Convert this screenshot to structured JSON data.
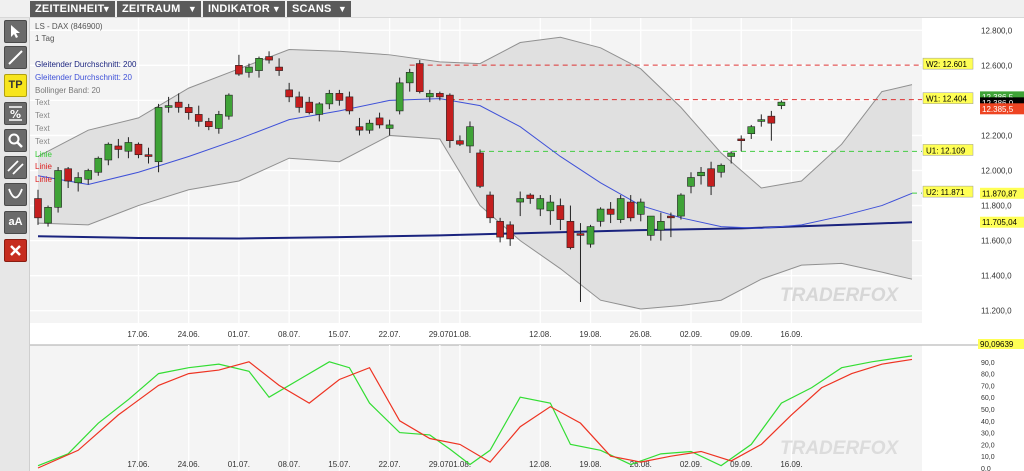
{
  "menu": [
    {
      "label": "ZEITEINHEIT"
    },
    {
      "label": "ZEITRAUM"
    },
    {
      "label": "INDIKATOR"
    },
    {
      "label": "SCANS"
    }
  ],
  "tools": [
    {
      "name": "cursor-icon",
      "label": ""
    },
    {
      "name": "line-tool-icon",
      "label": ""
    },
    {
      "name": "tp-tool-button",
      "label": "TP"
    },
    {
      "name": "percent-tool-icon",
      "label": ""
    },
    {
      "name": "zoom-icon",
      "label": ""
    },
    {
      "name": "channel-tool-icon",
      "label": ""
    },
    {
      "name": "curve-tool-icon",
      "label": ""
    },
    {
      "name": "font-size-button",
      "label": "aA"
    },
    {
      "name": "delete-icon",
      "label": ""
    }
  ],
  "colors": {
    "up": "#3fa337",
    "down": "#c41e1e",
    "sma200": "#1a237e",
    "sma20": "#3f51d8",
    "bollinger": "#909090",
    "stoch_k": "#33dd33",
    "stoch_d": "#ee3322",
    "resistance": "#dd3333",
    "support": "#44cc44",
    "tag_bg": "#ffff55"
  },
  "watermark": "TRADERFOX",
  "chart_data": {
    "type": "candlestick",
    "title": "LS - DAX (846900)",
    "subtitle": "1 Tag",
    "legend": [
      {
        "text": "Gleitender Durchschnitt: 200",
        "color": "#1a237e"
      },
      {
        "text": "Gleitender Durchschnitt: 20",
        "color": "#3f51d8"
      },
      {
        "text": "Bollinger Band: 20",
        "color": "#777777"
      },
      {
        "text": "Text",
        "color": "#888888"
      },
      {
        "text": "Text",
        "color": "#888888"
      },
      {
        "text": "Text",
        "color": "#888888"
      },
      {
        "text": "Text",
        "color": "#888888"
      },
      {
        "text": "Linie",
        "color": "#33cc33"
      },
      {
        "text": "Linie",
        "color": "#dd2222"
      },
      {
        "text": "Linie",
        "color": "#dd2222"
      }
    ],
    "xticks": [
      "17.06.",
      "24.06.",
      "01.07.",
      "08.07.",
      "15.07.",
      "22.07.",
      "29.07.",
      "01.08.",
      "12.08.",
      "19.08.",
      "26.08.",
      "02.09.",
      "09.09.",
      "16.09."
    ],
    "xtick_index": [
      10,
      15,
      20,
      25,
      30,
      35,
      40,
      42,
      50,
      55,
      60,
      65,
      70,
      75
    ],
    "yticks": [
      "12.800,0",
      "12.600,0",
      "12.400,0",
      "12.200,0",
      "12.000,0",
      "11.800,0",
      "11.600,0",
      "11.400,0",
      "11.200,0"
    ],
    "yvalues": [
      12800,
      12600,
      12400,
      12200,
      12000,
      11800,
      11600,
      11400,
      11200
    ],
    "ylim": [
      11130,
      12870
    ],
    "candles": [
      [
        11840,
        11890,
        11690,
        11730
      ],
      [
        11700,
        11800,
        11680,
        11790
      ],
      [
        11790,
        12020,
        11760,
        12000
      ],
      [
        12010,
        12020,
        11900,
        11940
      ],
      [
        11930,
        11990,
        11880,
        11960
      ],
      [
        11950,
        12010,
        11920,
        12000
      ],
      [
        11990,
        12080,
        11970,
        12070
      ],
      [
        12060,
        12160,
        12030,
        12150
      ],
      [
        12140,
        12180,
        12070,
        12120
      ],
      [
        12110,
        12190,
        12070,
        12160
      ],
      [
        12150,
        12160,
        12070,
        12090
      ],
      [
        12090,
        12130,
        12040,
        12080
      ],
      [
        12050,
        12380,
        11990,
        12360
      ],
      [
        12360,
        12420,
        12330,
        12370
      ],
      [
        12390,
        12440,
        12330,
        12360
      ],
      [
        12360,
        12380,
        12290,
        12330
      ],
      [
        12320,
        12370,
        12250,
        12280
      ],
      [
        12280,
        12300,
        12230,
        12250
      ],
      [
        12240,
        12340,
        12210,
        12320
      ],
      [
        12310,
        12440,
        12290,
        12430
      ],
      [
        12600,
        12660,
        12540,
        12550
      ],
      [
        12560,
        12610,
        12530,
        12590
      ],
      [
        12570,
        12650,
        12530,
        12640
      ],
      [
        12650,
        12680,
        12610,
        12630
      ],
      [
        12590,
        12640,
        12540,
        12570
      ],
      [
        12460,
        12500,
        12390,
        12420
      ],
      [
        12420,
        12450,
        12330,
        12360
      ],
      [
        12390,
        12420,
        12320,
        12330
      ],
      [
        12320,
        12390,
        12280,
        12380
      ],
      [
        12380,
        12460,
        12350,
        12440
      ],
      [
        12440,
        12460,
        12370,
        12400
      ],
      [
        12420,
        12450,
        12320,
        12340
      ],
      [
        12250,
        12300,
        12200,
        12230
      ],
      [
        12230,
        12290,
        12210,
        12270
      ],
      [
        12300,
        12330,
        12240,
        12260
      ],
      [
        12240,
        12290,
        12200,
        12260
      ],
      [
        12340,
        12530,
        12320,
        12500
      ],
      [
        12500,
        12580,
        12450,
        12560
      ],
      [
        12610,
        12630,
        12440,
        12450
      ],
      [
        12420,
        12460,
        12390,
        12440
      ],
      [
        12440,
        12450,
        12400,
        12420
      ],
      [
        12430,
        12440,
        12130,
        12170
      ],
      [
        12170,
        12200,
        12140,
        12150
      ],
      [
        12140,
        12280,
        12100,
        12250
      ],
      [
        12100,
        12120,
        11900,
        11910
      ],
      [
        11860,
        11880,
        11700,
        11730
      ],
      [
        11710,
        11730,
        11590,
        11620
      ],
      [
        11690,
        11710,
        11570,
        11610
      ],
      [
        11820,
        11880,
        11740,
        11840
      ],
      [
        11860,
        11870,
        11810,
        11840
      ],
      [
        11780,
        11860,
        11740,
        11840
      ],
      [
        11770,
        11860,
        11690,
        11820
      ],
      [
        11800,
        11840,
        11660,
        11720
      ],
      [
        11710,
        11800,
        11550,
        11560
      ],
      [
        11640,
        11700,
        11250,
        11630
      ],
      [
        11580,
        11690,
        11560,
        11680
      ],
      [
        11710,
        11790,
        11680,
        11780
      ],
      [
        11780,
        11820,
        11700,
        11750
      ],
      [
        11720,
        11860,
        11700,
        11840
      ],
      [
        11820,
        11860,
        11710,
        11730
      ],
      [
        11750,
        11840,
        11710,
        11820
      ],
      [
        11630,
        11740,
        11600,
        11740
      ],
      [
        11660,
        11760,
        11600,
        11710
      ],
      [
        11740,
        11760,
        11620,
        11730
      ],
      [
        11740,
        11870,
        11720,
        11860
      ],
      [
        11910,
        11990,
        11870,
        11960
      ],
      [
        11970,
        12020,
        11920,
        11990
      ],
      [
        12010,
        12050,
        11860,
        11910
      ],
      [
        11990,
        12040,
        11960,
        12030
      ],
      [
        12080,
        12110,
        12040,
        12100
      ],
      [
        12180,
        12200,
        12110,
        12170
      ],
      [
        12210,
        12260,
        12180,
        12250
      ],
      [
        12280,
        12320,
        12250,
        12290
      ],
      [
        12310,
        12340,
        12170,
        12270
      ],
      [
        12370,
        12400,
        12350,
        12390
      ]
    ],
    "sma200": [
      [
        0,
        11625
      ],
      [
        10,
        11615
      ],
      [
        20,
        11612
      ],
      [
        30,
        11620
      ],
      [
        40,
        11630
      ],
      [
        50,
        11645
      ],
      [
        60,
        11660
      ],
      [
        70,
        11670
      ],
      [
        80,
        11690
      ],
      [
        87,
        11705
      ]
    ],
    "sma20": [
      [
        0,
        11970
      ],
      [
        5,
        11920
      ],
      [
        10,
        11990
      ],
      [
        15,
        12080
      ],
      [
        20,
        12180
      ],
      [
        25,
        12290
      ],
      [
        30,
        12340
      ],
      [
        35,
        12400
      ],
      [
        40,
        12410
      ],
      [
        44,
        12370
      ],
      [
        48,
        12250
      ],
      [
        52,
        12080
      ],
      [
        56,
        11930
      ],
      [
        60,
        11800
      ],
      [
        64,
        11730
      ],
      [
        68,
        11680
      ],
      [
        72,
        11670
      ],
      [
        76,
        11690
      ],
      [
        80,
        11740
      ],
      [
        84,
        11800
      ],
      [
        87,
        11870
      ]
    ],
    "bollinger_upper": [
      [
        0,
        12080
      ],
      [
        5,
        12230
      ],
      [
        10,
        12300
      ],
      [
        15,
        12470
      ],
      [
        20,
        12580
      ],
      [
        25,
        12690
      ],
      [
        30,
        12680
      ],
      [
        35,
        12660
      ],
      [
        40,
        12620
      ],
      [
        44,
        12610
      ],
      [
        48,
        12730
      ],
      [
        52,
        12760
      ],
      [
        56,
        12700
      ],
      [
        60,
        12580
      ],
      [
        64,
        12360
      ],
      [
        68,
        12100
      ],
      [
        72,
        11900
      ],
      [
        76,
        11940
      ],
      [
        80,
        12150
      ],
      [
        84,
        12450
      ],
      [
        87,
        12490
      ]
    ],
    "bollinger_lower": [
      [
        0,
        11700
      ],
      [
        5,
        11690
      ],
      [
        10,
        11800
      ],
      [
        15,
        11890
      ],
      [
        20,
        11940
      ],
      [
        25,
        12070
      ],
      [
        30,
        12050
      ],
      [
        35,
        12200
      ],
      [
        40,
        12180
      ],
      [
        44,
        11800
      ],
      [
        48,
        11600
      ],
      [
        52,
        11440
      ],
      [
        56,
        11260
      ],
      [
        60,
        11210
      ],
      [
        64,
        11230
      ],
      [
        68,
        11260
      ],
      [
        72,
        11380
      ],
      [
        76,
        11460
      ],
      [
        80,
        11470
      ],
      [
        84,
        11420
      ],
      [
        87,
        11380
      ]
    ],
    "levels": [
      {
        "label": "W2: 12.601",
        "value": 12601,
        "color": "#dd3333",
        "from_index": 37
      },
      {
        "label": "W1: 12.404",
        "value": 12404,
        "color": "#dd3333",
        "from_index": 41
      },
      {
        "label": "U1: 12.109",
        "value": 12109,
        "color": "#44cc44",
        "from_index": 44
      },
      {
        "label": "U2: 11.871",
        "value": 11871,
        "color": "#44cc44",
        "from_index": 87
      }
    ],
    "price_tags": [
      {
        "text": "12.386,5",
        "value": 12420,
        "bg": "#3fa337",
        "fg": "#ffffff"
      },
      {
        "text": "12.386,0",
        "value": 12386,
        "bg": "#000000",
        "fg": "#ffffff"
      },
      {
        "text": "12.385,5",
        "value": 12352,
        "bg": "#ee4422",
        "fg": "#ffffff"
      },
      {
        "text": "11.870,87",
        "value": 11870,
        "bg": "#ffff55",
        "fg": "#000000"
      },
      {
        "text": "11.705,04",
        "value": 11705,
        "bg": "#ffff55",
        "fg": "#000000"
      }
    ],
    "oscillator": {
      "yticks": [
        "90,0",
        "80,0",
        "70,0",
        "60,0",
        "50,0",
        "40,0",
        "30,0",
        "20,0",
        "10,0",
        "0,0"
      ],
      "ylim": [
        0,
        100
      ],
      "last_label": "90,09639",
      "k": [
        [
          0,
          2
        ],
        [
          3,
          12
        ],
        [
          6,
          38
        ],
        [
          9,
          58
        ],
        [
          12,
          80
        ],
        [
          15,
          85
        ],
        [
          18,
          88
        ],
        [
          21,
          82
        ],
        [
          23,
          60
        ],
        [
          26,
          75
        ],
        [
          29,
          90
        ],
        [
          31,
          85
        ],
        [
          33,
          55
        ],
        [
          36,
          30
        ],
        [
          39,
          28
        ],
        [
          41,
          16
        ],
        [
          43,
          3
        ],
        [
          45,
          15
        ],
        [
          48,
          60
        ],
        [
          51,
          55
        ],
        [
          53,
          20
        ],
        [
          56,
          15
        ],
        [
          59,
          3
        ],
        [
          62,
          12
        ],
        [
          65,
          14
        ],
        [
          68,
          2
        ],
        [
          71,
          20
        ],
        [
          74,
          55
        ],
        [
          77,
          68
        ],
        [
          80,
          85
        ],
        [
          83,
          90
        ],
        [
          87,
          95
        ]
      ],
      "d": [
        [
          0,
          0
        ],
        [
          4,
          15
        ],
        [
          8,
          45
        ],
        [
          12,
          70
        ],
        [
          15,
          80
        ],
        [
          18,
          83
        ],
        [
          21,
          90
        ],
        [
          24,
          70
        ],
        [
          27,
          55
        ],
        [
          30,
          75
        ],
        [
          33,
          85
        ],
        [
          36,
          40
        ],
        [
          39,
          25
        ],
        [
          42,
          20
        ],
        [
          45,
          5
        ],
        [
          48,
          35
        ],
        [
          51,
          52
        ],
        [
          54,
          38
        ],
        [
          57,
          10
        ],
        [
          60,
          5
        ],
        [
          63,
          10
        ],
        [
          66,
          14
        ],
        [
          69,
          6
        ],
        [
          72,
          20
        ],
        [
          75,
          45
        ],
        [
          78,
          68
        ],
        [
          81,
          80
        ],
        [
          84,
          88
        ],
        [
          87,
          92
        ]
      ]
    }
  }
}
